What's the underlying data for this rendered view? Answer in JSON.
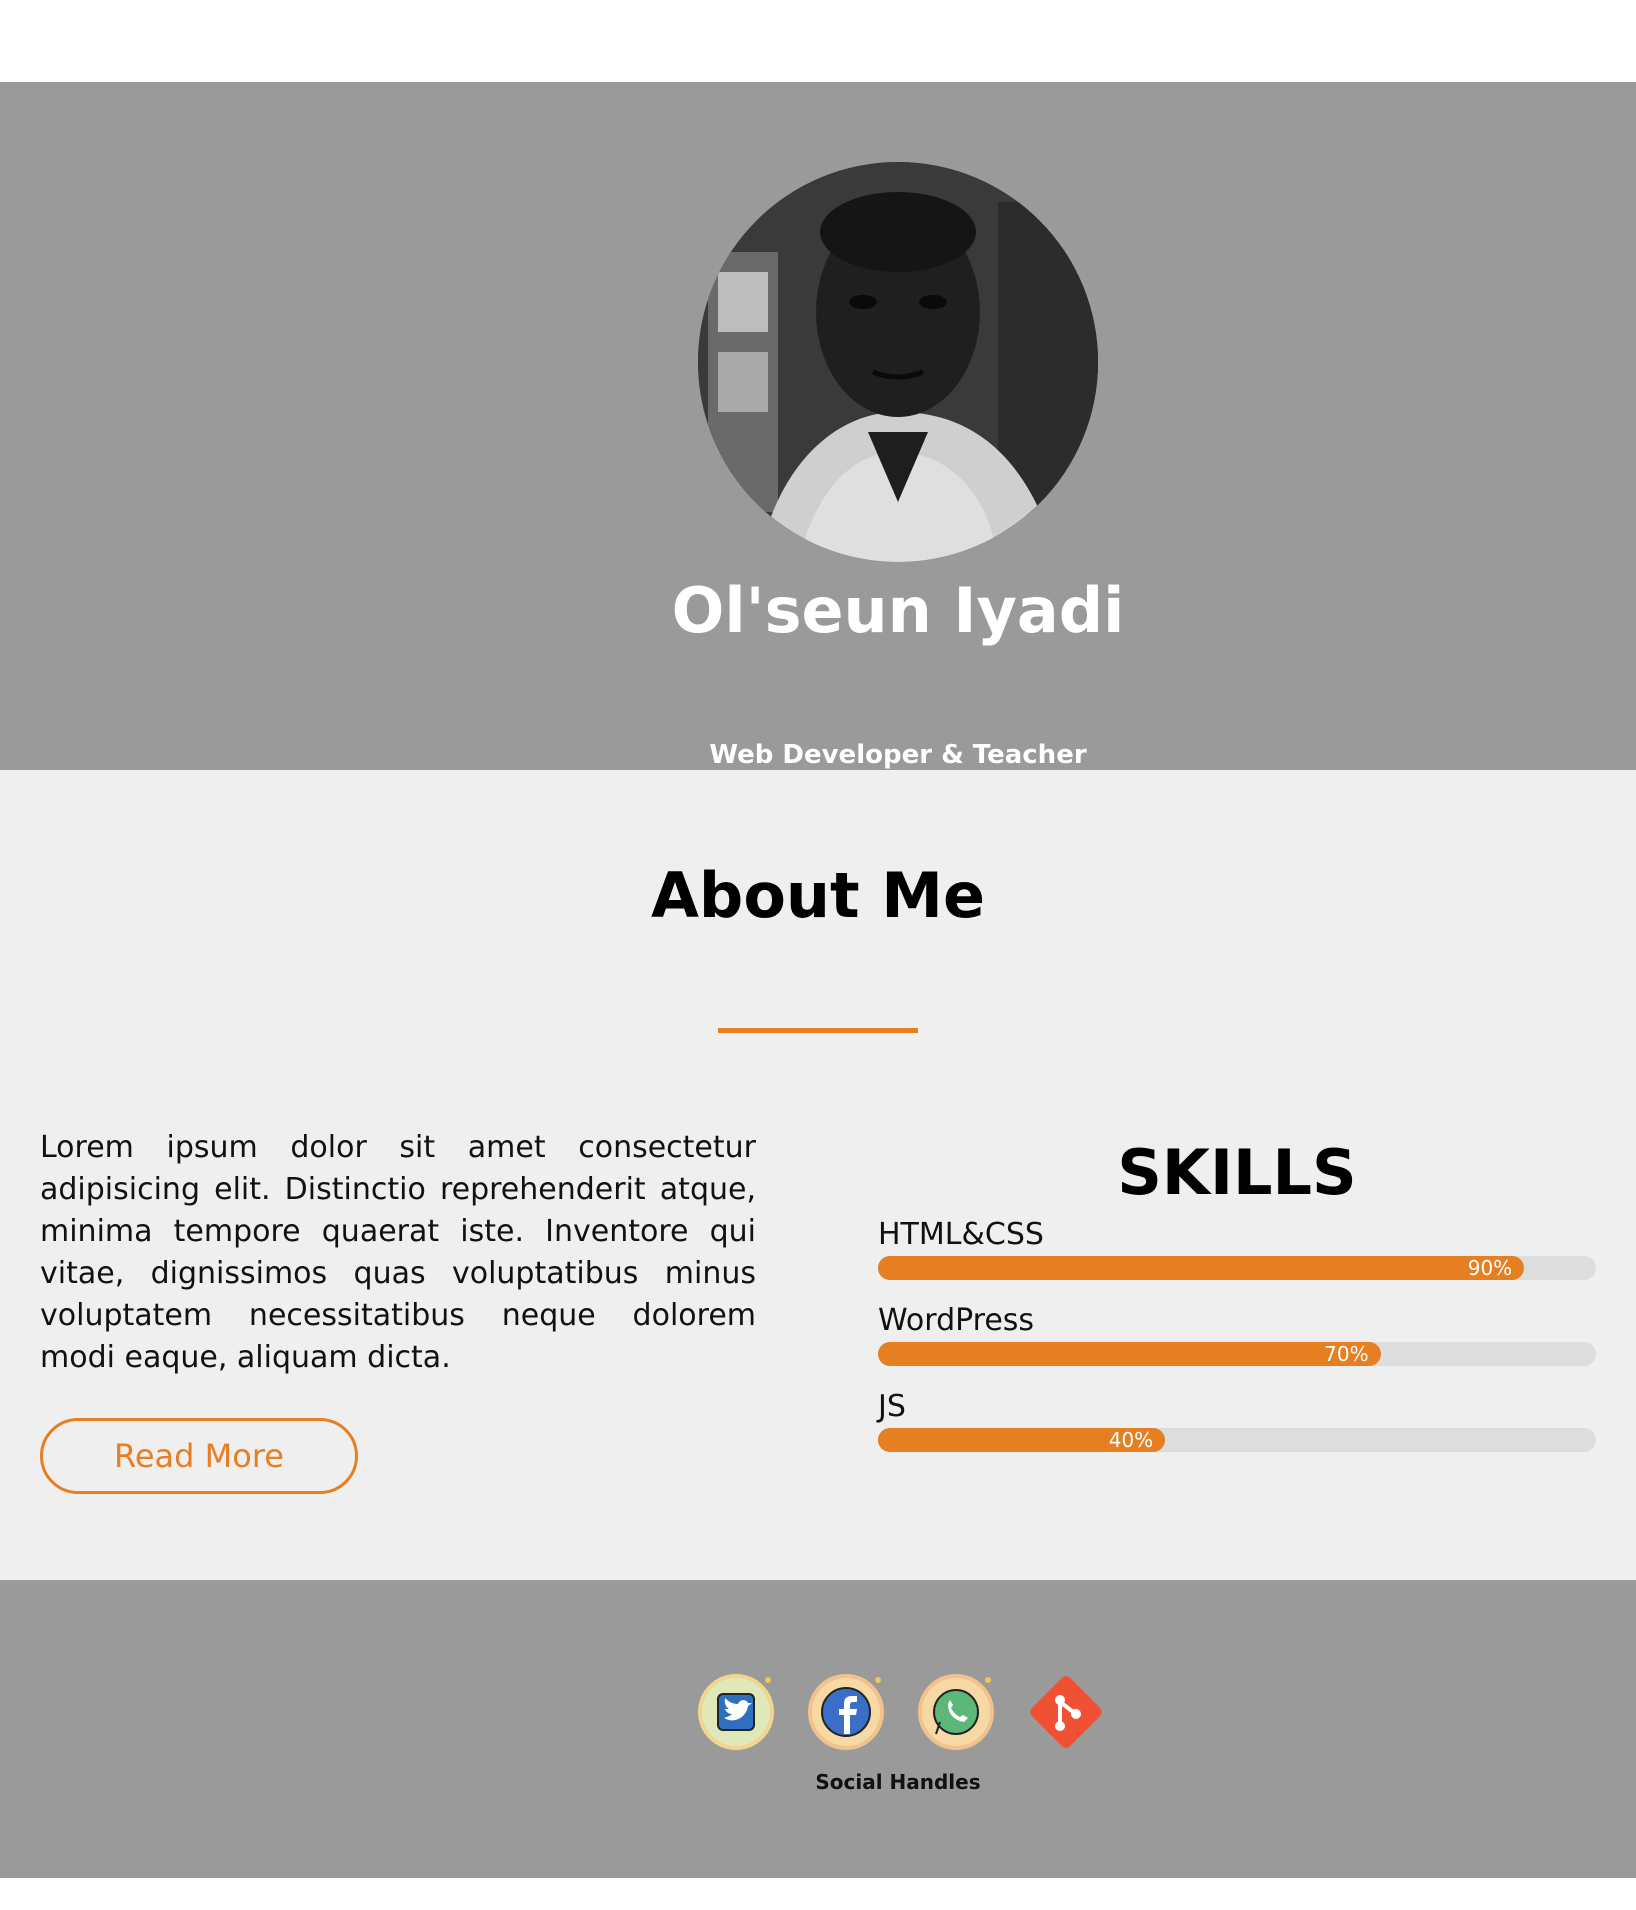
{
  "hero": {
    "name": "Ol'seun Iyadi",
    "subtitle": "Web Developer & Teacher",
    "background": "#9a9a9a"
  },
  "about": {
    "title": "About Me",
    "paragraph": "Lorem ipsum dolor sit amet consectetur adipisicing elit. Distinctio reprehenderit atque, minima tempore quaerat iste. Inventore qui vitae, dignissimos quas voluptatibus minus voluptatem necessitatibus neque dolorem modi eaque, aliquam dicta.",
    "read_more_label": "Read More",
    "accent_color": "#e67e22"
  },
  "skills": {
    "title": "SKILLS",
    "items": [
      {
        "label": "HTML&CSS",
        "percent_label": "90%",
        "percent": 90
      },
      {
        "label": "WordPress",
        "percent_label": "70%",
        "percent": 70
      },
      {
        "label": "JS",
        "percent_label": "40%",
        "percent": 40
      }
    ]
  },
  "footer": {
    "social_label": "Social Handles",
    "icons": [
      "twitter-icon",
      "facebook-icon",
      "whatsapp-icon",
      "git-icon"
    ]
  }
}
